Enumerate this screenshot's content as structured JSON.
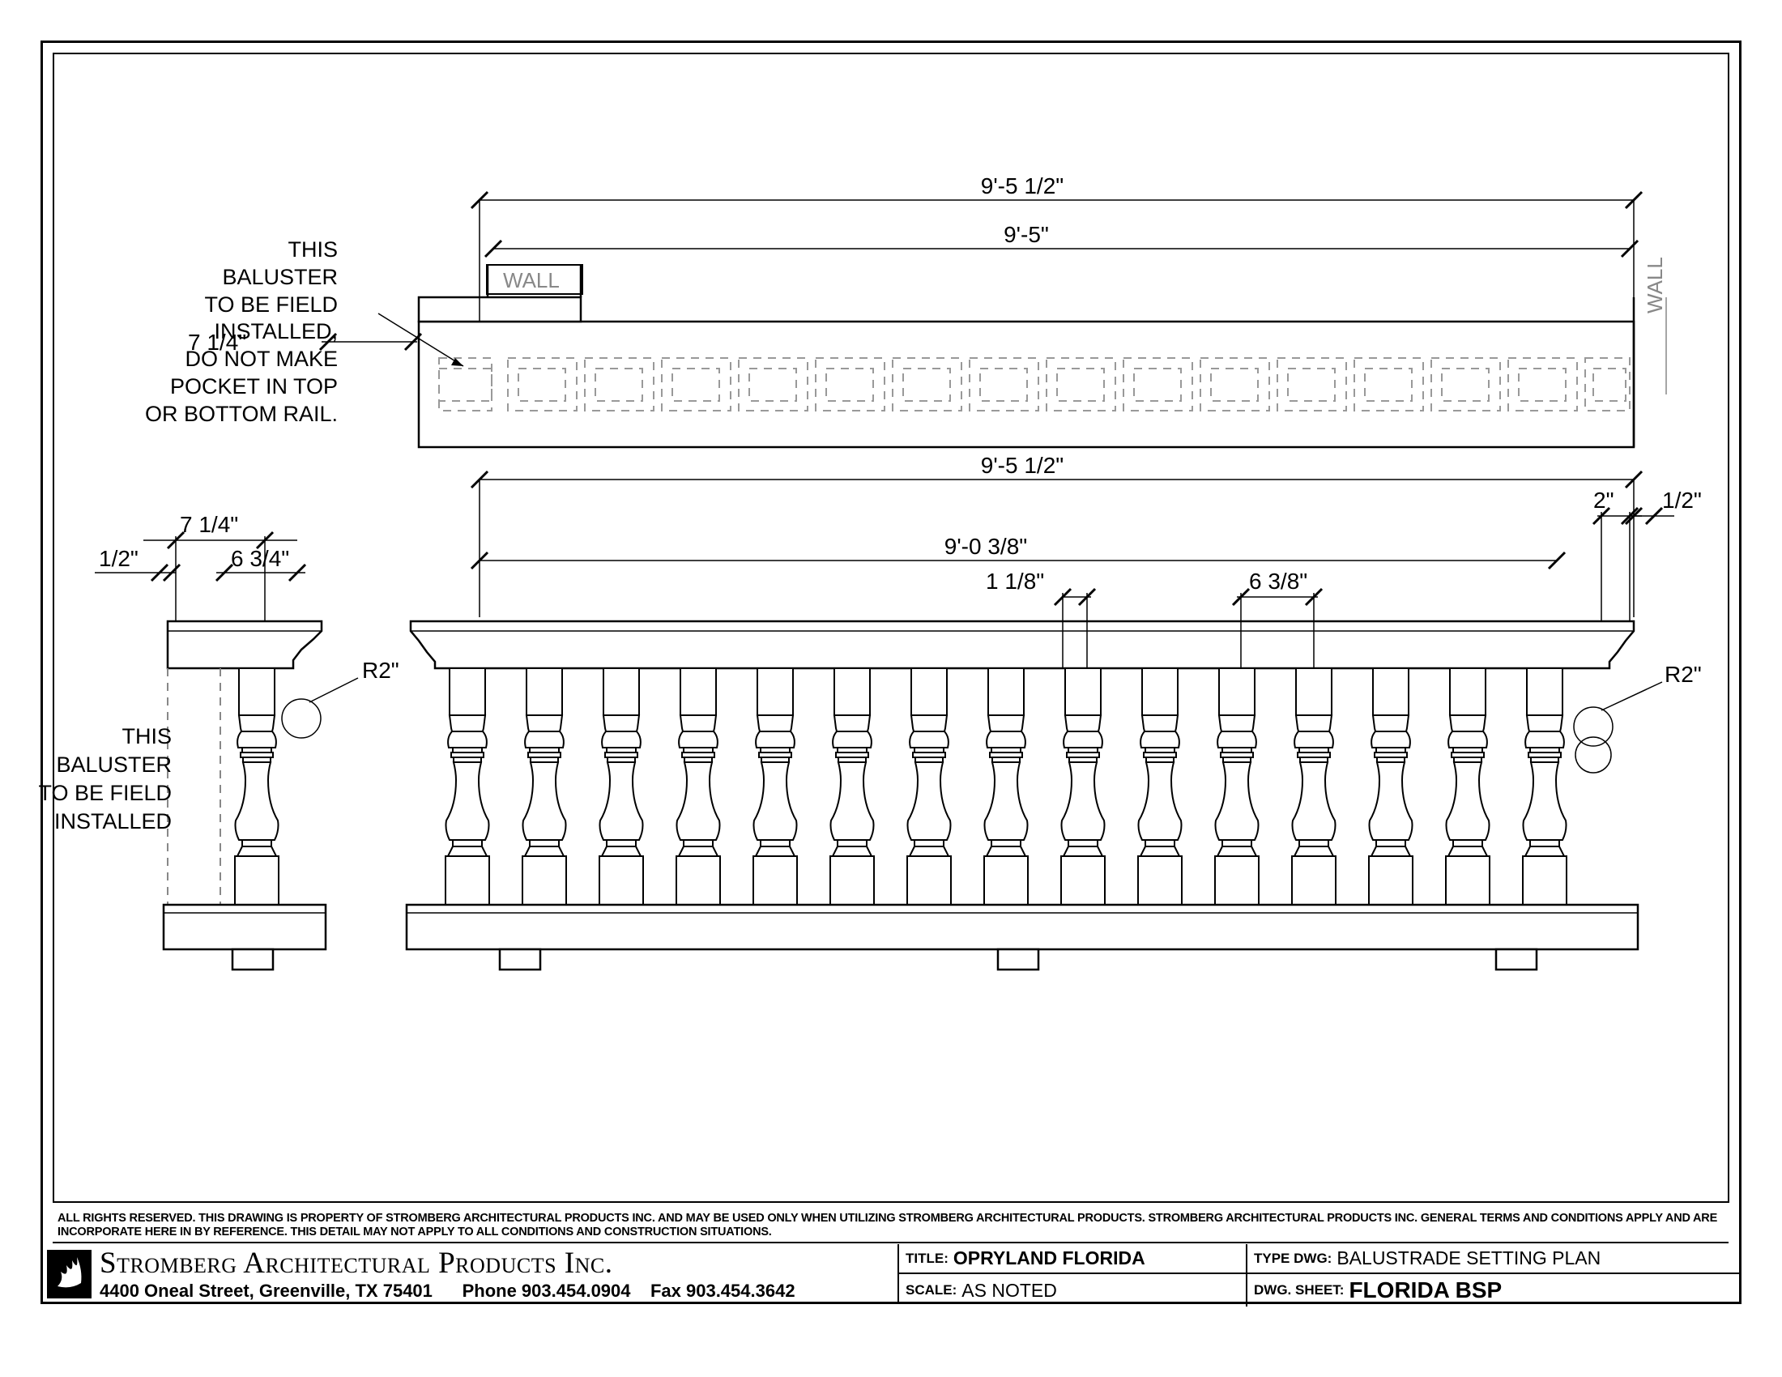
{
  "title_block": {
    "company": "Stromberg Architectural Products Inc.",
    "address": "4400 Oneal Street, Greenville, TX  75401",
    "phone": "Phone 903.454.0904",
    "fax": "Fax 903.454.3642",
    "title_label": "TITLE:",
    "title_value": "OPRYLAND FLORIDA",
    "type_label": "TYPE DWG:",
    "type_value": "BALUSTRADE SETTING PLAN",
    "scale_label": "SCALE:",
    "scale_value": "AS NOTED",
    "sheet_label": "DWG. SHEET:",
    "sheet_value": "FLORIDA BSP"
  },
  "legal": "ALL RIGHTS RESERVED. THIS DRAWING IS PROPERTY OF STROMBERG ARCHITECTURAL PRODUCTS INC. AND MAY BE USED ONLY WHEN UTILIZING STROMBERG ARCHITECTURAL PRODUCTS.  STROMBERG ARCHITECTURAL PRODUCTS INC. GENERAL TERMS AND CONDITIONS APPLY AND ARE INCORPORATE HERE IN BY REFERENCE.  THIS DETAIL MAY NOT APPLY TO ALL CONDITIONS AND CONSTRUCTION SITUATIONS.",
  "notes": {
    "top": "THIS\nBALUSTER\nTO BE FIELD\nINSTALLED,\nDO NOT MAKE\nPOCKET IN TOP\nOR BOTTOM RAIL.",
    "side": "THIS\nBALUSTER\nTO BE FIELD\nINSTALLED"
  },
  "labels": {
    "wall": "WALL",
    "r2_left": "R2\"",
    "r2_right": "R2\""
  },
  "dims": {
    "plan_overall": "9'-5 1/2\"",
    "plan_inner": "9'-5\"",
    "top_note_dim": "7 1/4\"",
    "elev_overall": "9'-5 1/2\"",
    "elev_inner": "9'-0 3/8\"",
    "baluster_gap": "1 1/8\"",
    "baluster_spacing": "6 3/8\"",
    "end_2": "2\"",
    "end_half": "1/2\"",
    "side_7_14": "7 1/4\"",
    "side_half": "1/2\"",
    "side_6_34": "6 3/4\""
  }
}
